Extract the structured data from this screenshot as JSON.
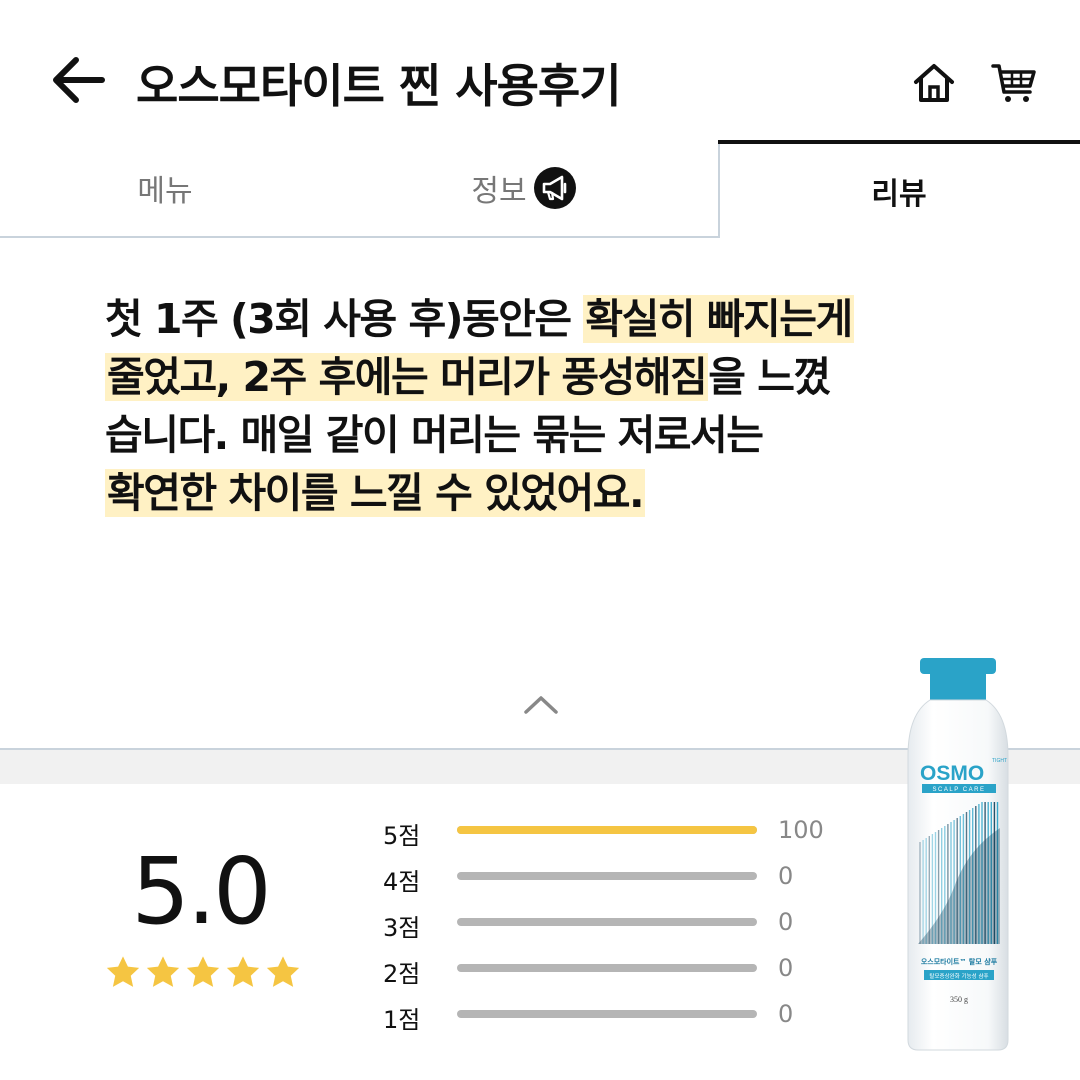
{
  "header": {
    "title": "오스모타이트 찐 사용후기",
    "back_icon": "arrow-left-icon",
    "home_icon": "home-icon",
    "cart_icon": "cart-icon"
  },
  "tabs": [
    {
      "label": "메뉴",
      "active": false
    },
    {
      "label": "정보",
      "active": false,
      "icon": "megaphone-icon"
    },
    {
      "label": "리뷰",
      "active": true
    }
  ],
  "review": {
    "lines": [
      [
        {
          "text": "첫 1주 (3회 사용 후)동안은 ",
          "hl": false
        },
        {
          "text": "확실히 빠지는게",
          "hl": true
        }
      ],
      [
        {
          "text": "줄었고, 2주 후에는 머리가 풍성해짐",
          "hl": true
        },
        {
          "text": "을 느꼈",
          "hl": false
        }
      ],
      [
        {
          "text": "습니다. 매일 같이 머리는 묶는 저로서는",
          "hl": false
        }
      ],
      [
        {
          "text": "확연한 차이를 느낄 수 있었어요.",
          "hl": true
        }
      ]
    ],
    "highlight_color": "#fff1c4"
  },
  "rating": {
    "score": "5.0",
    "stars": 5,
    "star_color": "#f5c542",
    "distribution": [
      {
        "label": "5점",
        "count": "100",
        "fraction": 1.0
      },
      {
        "label": "4점",
        "count": "0",
        "fraction": 0
      },
      {
        "label": "3점",
        "count": "0",
        "fraction": 0
      },
      {
        "label": "2점",
        "count": "0",
        "fraction": 0
      },
      {
        "label": "1점",
        "count": "0",
        "fraction": 0
      }
    ]
  },
  "product": {
    "brand": "OSMO",
    "brand_sup": "TIGHT",
    "sub_brand": "SCALP CARE",
    "name": "오스모타이트™ 탈모 샴푸",
    "desc": "탈모증상완화 기능성 샴푸",
    "weight": "350 g",
    "accent_color": "#2aa3c8"
  }
}
